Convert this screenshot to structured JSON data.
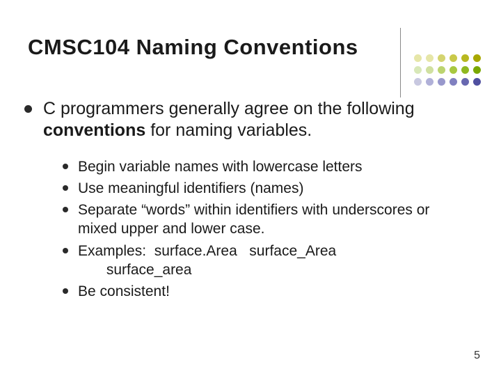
{
  "title": "CMSC104 Naming Conventions",
  "intro": {
    "before": "C programmers generally agree on the following ",
    "bold": "conventions",
    "after": " for naming variables."
  },
  "items": {
    "i0": "Begin variable names with lowercase letters",
    "i1": "Use meaningful identifiers (names)",
    "i2": "Separate “words” within identifiers with underscores or mixed upper and lower case.",
    "i3a": "Examples:  surface.Area   surface_Area",
    "i3b": "       surface_area",
    "i4": "Be consistent!"
  },
  "page_number": "5",
  "dot_colors": [
    "#e6e6a8",
    "#e6e6a8",
    "#d4d470",
    "#c9c94a",
    "#b8b820",
    "#a8a800",
    "#d8e8b8",
    "#d0e0a0",
    "#bcd470",
    "#a8c840",
    "#8fb820",
    "#7aa800",
    "#c8c8e0",
    "#b0b0d8",
    "#9898cc",
    "#8080c0",
    "#6868b0",
    "#5050a0"
  ]
}
